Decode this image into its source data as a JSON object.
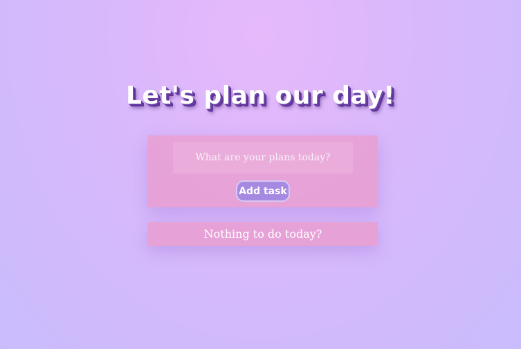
{
  "header": {
    "title": "Let's plan our day!"
  },
  "form": {
    "input_placeholder": "What are your plans today?",
    "input_value": "",
    "add_button_label": "Add task"
  },
  "tasks": {
    "empty_message": "Nothing to do today?"
  },
  "colors": {
    "background": "#d9b8fb",
    "panel": "#e89fcf",
    "button": "#a68ae2",
    "title_shadow": "#6a3fa8"
  }
}
